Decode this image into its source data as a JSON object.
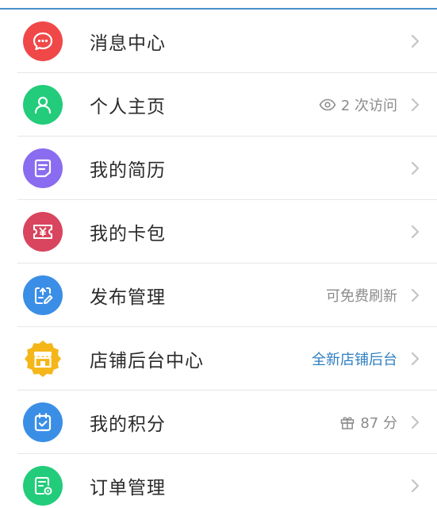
{
  "menu": {
    "items": [
      {
        "label": "消息中心",
        "extra": "",
        "icon": "chat-bubble-icon",
        "color": "#f04848"
      },
      {
        "label": "个人主页",
        "extra": "2 次访问",
        "extra_icon": "eye-icon",
        "icon": "person-icon",
        "color": "#22cc7a"
      },
      {
        "label": "我的简历",
        "extra": "",
        "icon": "resume-icon",
        "color": "#8a6cf0"
      },
      {
        "label": "我的卡包",
        "extra": "",
        "icon": "yen-card-icon",
        "color": "#d9455e"
      },
      {
        "label": "发布管理",
        "extra": "可免费刷新",
        "icon": "publish-edit-icon",
        "color": "#3a8ee6"
      },
      {
        "label": "店铺后台中心",
        "extra": "全新店铺后台",
        "icon": "store-icon",
        "color": "#f5b61a",
        "extra_color": "#2f7fc1"
      },
      {
        "label": "我的积分",
        "extra": "87 分",
        "extra_icon": "gift-icon",
        "icon": "calendar-check-icon",
        "color": "#3a8ee6"
      },
      {
        "label": "订单管理",
        "extra": "",
        "icon": "order-icon",
        "color": "#22cc7a"
      }
    ]
  }
}
